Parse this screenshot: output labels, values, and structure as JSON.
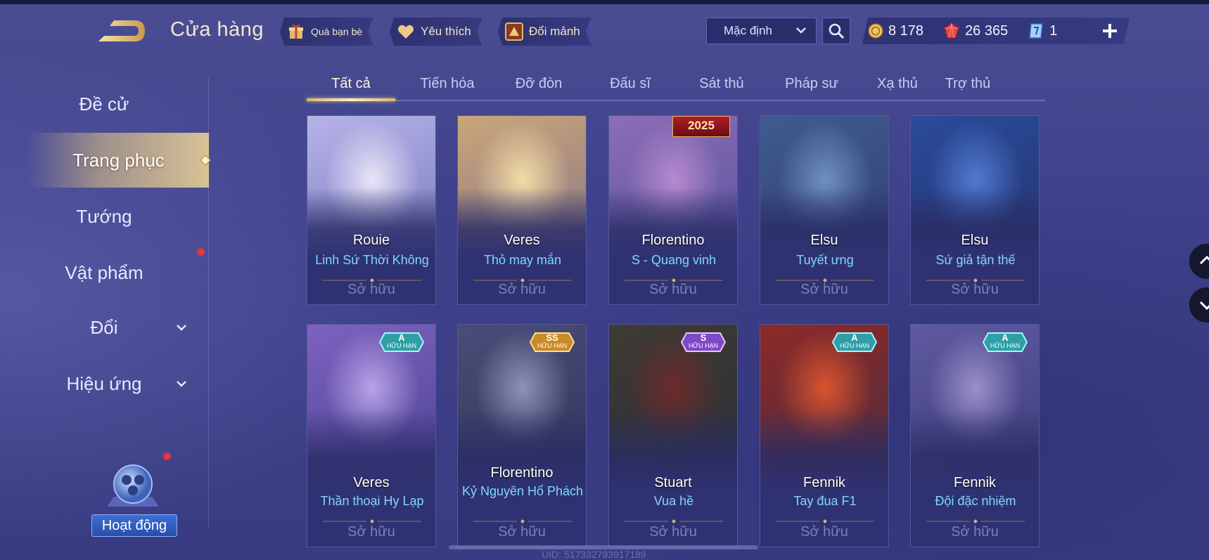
{
  "header": {
    "title": "Cửa hàng",
    "gift_label": "Quà bạn bè",
    "favorite_label": "Yêu thích",
    "exchange_label": "Đổi mảnh",
    "sort_value": "Mặc định",
    "currency": {
      "gold": "8 178",
      "voucher": "26 365",
      "token": "1"
    }
  },
  "sidebar": {
    "items": [
      {
        "label": "Đề cử"
      },
      {
        "label": "Trang phục"
      },
      {
        "label": "Tướng"
      },
      {
        "label": "Vật phẩm"
      },
      {
        "label": "Đổi"
      },
      {
        "label": "Hiệu ứng"
      }
    ],
    "activity_label": "Hoạt động"
  },
  "tabs": [
    "Tất cả",
    "Tiến hóa",
    "Đỡ đòn",
    "Đấu sĩ",
    "Sát thủ",
    "Pháp sư",
    "Xạ thủ",
    "Trợ thủ"
  ],
  "cards": [
    {
      "hero": "Rouie",
      "skin": "Linh Sứ Thời Không",
      "status": "Sở hữu",
      "art": [
        "#e9e6f7",
        "#b7b3e8",
        "#6c6fb8"
      ]
    },
    {
      "hero": "Veres",
      "skin": "Thỏ may mắn",
      "status": "Sở hữu",
      "art": [
        "#f3dba8",
        "#caa67a",
        "#7a6a86"
      ]
    },
    {
      "hero": "Florentino",
      "skin": "S - Quang vinh",
      "status": "Sở hữu",
      "art": [
        "#b789d0",
        "#8c6db6",
        "#4c4f98"
      ],
      "event": "2025"
    },
    {
      "hero": "Elsu",
      "skin": "Tuyết ưng",
      "status": "Sở hữu",
      "art": [
        "#6f8fbf",
        "#3f5b8f",
        "#2f3a6e"
      ]
    },
    {
      "hero": "Elsu",
      "skin": "Sứ giả tận thế",
      "status": "Sở hữu",
      "art": [
        "#4f7ad0",
        "#2b4b9a",
        "#232f66"
      ]
    },
    {
      "hero": "Veres",
      "skin": "Thần thoại Hy Lạp",
      "status": "Sở hữu",
      "art": [
        "#b7a3e6",
        "#7d62c0",
        "#3e3a86"
      ],
      "badge": {
        "rank": "A",
        "sub": "HỮU HẠN"
      }
    },
    {
      "hero": "Florentino",
      "skin": "Kỷ Nguyên Hổ Phách",
      "status": "Sở hữu",
      "art": [
        "#8e92b7",
        "#4a4d77",
        "#2a2c52"
      ],
      "badge": {
        "rank": "SS",
        "sub": "HỮU HẠN"
      }
    },
    {
      "hero": "Stuart",
      "skin": "Vua hề",
      "status": "Sở hữu",
      "art": [
        "#6d2a2a",
        "#3f3b33",
        "#252a3c"
      ],
      "badge": {
        "rank": "S",
        "sub": "HỮU HẠN"
      }
    },
    {
      "hero": "Fennik",
      "skin": "Tay đua F1",
      "status": "Sở hữu",
      "art": [
        "#d8542f",
        "#8c2a28",
        "#3b2c44"
      ],
      "badge": {
        "rank": "A",
        "sub": "HỮU HẠN"
      }
    },
    {
      "hero": "Fennik",
      "skin": "Đội đặc nhiệm",
      "status": "Sở hữu",
      "art": [
        "#9b8fc9",
        "#5f5aa0",
        "#33346e"
      ],
      "badge": {
        "rank": "A",
        "sub": "HỮU HẠN"
      }
    }
  ],
  "footer": {
    "uid": "UID: 517332793917189"
  },
  "colors": {
    "accent_gold": "#d8b66b",
    "skin_name": "#7fd6ff",
    "owned": "#7c80b8"
  }
}
